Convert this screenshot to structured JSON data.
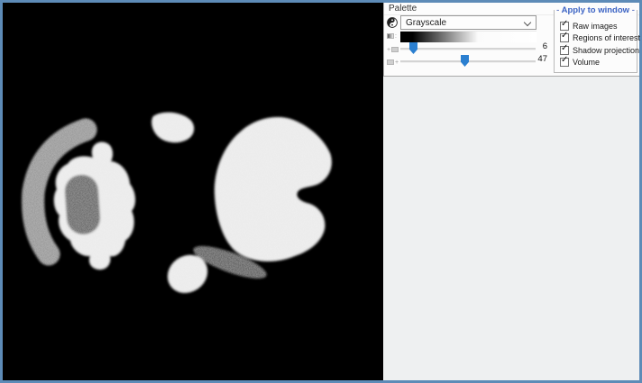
{
  "window": {
    "border_color": "#5d8bb7",
    "panel_bg": "#eef0f1"
  },
  "icons": {
    "invert_palette": "yin-yang-icon",
    "dropdown_arrow": "chevron-down-icon",
    "close": "close-icon",
    "gradient_preview": "gradient-mini-icon",
    "range_start": "range-start-icon",
    "range_end": "range-end-icon"
  },
  "image_viewer": {
    "background": "#000000",
    "content": "axial CT slice rendered with grayscale palette",
    "colors": {
      "soft_tissue_white": "#e9e9e9",
      "crescent_gray": "#8d8d8d",
      "capsule_dark": "#4d4d4d",
      "streak_dark": "#414141"
    }
  },
  "palette": {
    "title": "Palette",
    "close_label": "×",
    "colormap": {
      "selected": "Grayscale"
    },
    "gradient": {
      "start_color": "#000000",
      "end_color": "#ffffff"
    },
    "range": {
      "low": {
        "value": "6",
        "percent": 7
      },
      "high": {
        "value": "47",
        "percent": 48
      }
    },
    "slider_color": "#2b7fd0",
    "mini_labels": {
      "gradient_suffix": ":",
      "plus": "+"
    },
    "apply_group": {
      "legend": "Apply to window",
      "legend_dash": "-",
      "legend_color": "#3b63c4",
      "checkmark": "✓",
      "options": [
        {
          "label": "Raw images",
          "checked": true
        },
        {
          "label": "Regions of interest",
          "checked": true
        },
        {
          "label": "Shadow projection",
          "checked": true
        },
        {
          "label": "Volume",
          "checked": true
        }
      ]
    }
  }
}
